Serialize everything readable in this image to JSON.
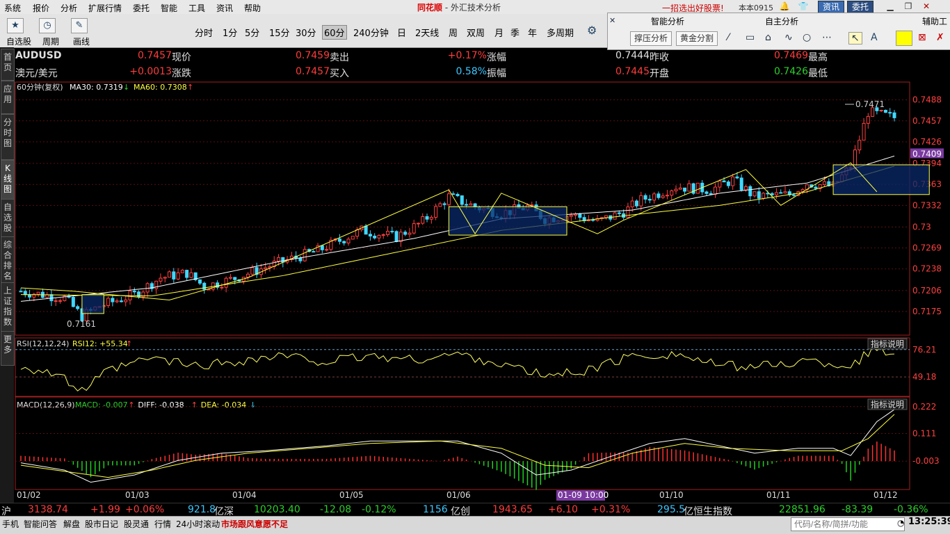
{
  "menu": [
    "系统",
    "报价",
    "分析",
    "扩展行情",
    "委托",
    "智能",
    "工具",
    "资讯",
    "帮助"
  ],
  "app_title": {
    "brand": "同花顺",
    "sep": " - ",
    "title": "外汇技术分析"
  },
  "promo": "一招选出好股票!",
  "version": "本本0915",
  "top_buttons": {
    "news": "资讯",
    "trade": "委托"
  },
  "toolbar": {
    "buttons": [
      {
        "label": "自选股"
      },
      {
        "label": "周期"
      },
      {
        "label": "画线"
      }
    ],
    "periods": [
      "分时",
      "1分",
      "5分",
      "15分",
      "30分",
      "60分",
      "240分钟",
      "日",
      "2天线",
      "周",
      "双周",
      "月",
      "季",
      "年",
      "多周期"
    ],
    "active_period": "60分"
  },
  "analysis_panel": {
    "tabs": [
      "智能分析",
      "自主分析",
      "辅助工"
    ],
    "buttons": [
      "撑压分析",
      "黄金分割"
    ]
  },
  "sidebar": [
    "首页",
    "应用",
    "分时图",
    "K线图",
    "自选股",
    "综合排名",
    "上证指数",
    "更多"
  ],
  "sidebar_active": "K线图",
  "quote": {
    "symbol": "AUDUSD",
    "name": "澳元/美元",
    "fields": [
      {
        "label": "现价",
        "value": "0.7457",
        "color": "#ff3c3c"
      },
      {
        "label": "卖出",
        "value": "0.7459",
        "color": "#ff3c3c"
      },
      {
        "label": "涨幅",
        "value": "+0.17%",
        "color": "#ff3c3c"
      },
      {
        "label": "昨收",
        "value": "0.7444",
        "color": "#e0e0e0"
      },
      {
        "label": "最高",
        "value": "0.7469",
        "color": "#ff3c3c"
      },
      {
        "label": "涨跌",
        "value": "+0.0013",
        "color": "#ff3c3c"
      },
      {
        "label": "买入",
        "value": "0.7457",
        "color": "#ff3c3c"
      },
      {
        "label": "振幅",
        "value": "0.58%",
        "color": "#3cc8ff"
      },
      {
        "label": "开盘",
        "value": "0.7445",
        "color": "#ff3c3c"
      },
      {
        "label": "最低",
        "value": "0.7426",
        "color": "#2bd12b"
      }
    ]
  },
  "chart_data": {
    "type": "candlestick",
    "period_label": "60分钟(复权)",
    "ma_legend": [
      {
        "name": "MA30",
        "value": "0.7319",
        "arrow": "↓",
        "color": "#ffffff"
      },
      {
        "name": "MA60",
        "value": "0.7308",
        "arrow": "↑",
        "color": "#ffff40"
      }
    ],
    "y_ticks": [
      0.7488,
      0.7457,
      0.7426,
      0.7394,
      0.7363,
      0.7332,
      0.73,
      0.7269,
      0.7238,
      0.7206,
      0.7175
    ],
    "ylim": [
      0.714,
      0.75
    ],
    "current_price_tag": "0.7409",
    "annotations": [
      {
        "text": "0.7471",
        "kind": "high"
      },
      {
        "text": "0.7161",
        "kind": "low"
      }
    ],
    "x_labels": [
      "01/02",
      "01/03",
      "01/04",
      "01/05",
      "01/06",
      "01/10",
      "01/11",
      "01/12"
    ],
    "cursor_label": "01-09 10:00",
    "candle_count": 150,
    "anchors": [
      [
        0,
        0.7205
      ],
      [
        10,
        0.7195
      ],
      [
        14,
        0.7168
      ],
      [
        18,
        0.7183
      ],
      [
        26,
        0.72
      ],
      [
        32,
        0.7225
      ],
      [
        38,
        0.7232
      ],
      [
        42,
        0.7212
      ],
      [
        48,
        0.7222
      ],
      [
        58,
        0.7245
      ],
      [
        68,
        0.7265
      ],
      [
        78,
        0.7295
      ],
      [
        86,
        0.7285
      ],
      [
        92,
        0.7308
      ],
      [
        98,
        0.7345
      ],
      [
        104,
        0.733
      ],
      [
        110,
        0.732
      ],
      [
        116,
        0.733
      ],
      [
        120,
        0.7312
      ],
      [
        126,
        0.7318
      ],
      [
        132,
        0.7308
      ],
      [
        138,
        0.7322
      ],
      [
        142,
        0.734
      ],
      [
        150,
        0.736
      ],
      [
        158,
        0.7355
      ],
      [
        163,
        0.737
      ],
      [
        168,
        0.7345
      ],
      [
        176,
        0.7348
      ],
      [
        180,
        0.7365
      ],
      [
        186,
        0.736
      ],
      [
        190,
        0.739
      ],
      [
        194,
        0.747
      ],
      [
        200,
        0.7462
      ]
    ],
    "ma30": [
      [
        0,
        0.719
      ],
      [
        30,
        0.721
      ],
      [
        60,
        0.725
      ],
      [
        90,
        0.7283
      ],
      [
        110,
        0.7312
      ],
      [
        140,
        0.7325
      ],
      [
        160,
        0.735
      ],
      [
        180,
        0.7365
      ],
      [
        200,
        0.7405
      ]
    ],
    "ma60": [
      [
        0,
        0.72
      ],
      [
        30,
        0.7198
      ],
      [
        60,
        0.7228
      ],
      [
        90,
        0.7268
      ],
      [
        110,
        0.7295
      ],
      [
        140,
        0.7318
      ],
      [
        160,
        0.7332
      ],
      [
        180,
        0.7352
      ],
      [
        200,
        0.739
      ]
    ],
    "rsi": {
      "label": "RSI(12,12,24)",
      "value_label": "RSI12: +55.34",
      "arrow": "↑",
      "y_ticks": [
        "76.21",
        "49.18"
      ],
      "ylim": [
        30,
        85
      ],
      "anchors": [
        [
          0,
          60
        ],
        [
          8,
          52
        ],
        [
          14,
          35
        ],
        [
          20,
          55
        ],
        [
          30,
          68
        ],
        [
          40,
          60
        ],
        [
          50,
          65
        ],
        [
          60,
          70
        ],
        [
          70,
          64
        ],
        [
          80,
          70
        ],
        [
          90,
          66
        ],
        [
          100,
          72
        ],
        [
          110,
          62
        ],
        [
          120,
          50
        ],
        [
          130,
          56
        ],
        [
          140,
          70
        ],
        [
          150,
          72
        ],
        [
          160,
          60
        ],
        [
          170,
          60
        ],
        [
          180,
          65
        ],
        [
          190,
          60
        ],
        [
          195,
          76
        ],
        [
          200,
          72
        ]
      ]
    },
    "macd": {
      "label": "MACD(12,26,9)",
      "legend": [
        {
          "name": "MACD",
          "value": "-0.007",
          "arrow": "↑",
          "color": "#2bd12b"
        },
        {
          "name": "DIFF",
          "value": "-0.038",
          "arrow": "↑",
          "color": "#ffffff"
        },
        {
          "name": "DEA",
          "value": "-0.034",
          "arrow": "↓",
          "color": "#ffff40"
        }
      ],
      "y_ticks": [
        "0.222",
        "0.111",
        "-0.003"
      ],
      "ylim": [
        -0.12,
        0.25
      ],
      "diff_anchors": [
        [
          0,
          -0.01
        ],
        [
          10,
          -0.04
        ],
        [
          16,
          -0.09
        ],
        [
          26,
          -0.06
        ],
        [
          36,
          0.0
        ],
        [
          46,
          0.03
        ],
        [
          56,
          0.04
        ],
        [
          70,
          0.06
        ],
        [
          80,
          0.08
        ],
        [
          90,
          0.08
        ],
        [
          100,
          0.08
        ],
        [
          110,
          0.03
        ],
        [
          118,
          -0.06
        ],
        [
          126,
          -0.04
        ],
        [
          134,
          0.01
        ],
        [
          144,
          0.07
        ],
        [
          152,
          0.09
        ],
        [
          160,
          0.06
        ],
        [
          168,
          0.03
        ],
        [
          178,
          0.05
        ],
        [
          186,
          0.05
        ],
        [
          190,
          0.02
        ],
        [
          196,
          0.16
        ],
        [
          200,
          0.21
        ]
      ],
      "dea_anchors": [
        [
          0,
          -0.02
        ],
        [
          12,
          -0.05
        ],
        [
          20,
          -0.07
        ],
        [
          30,
          -0.04
        ],
        [
          40,
          0.0
        ],
        [
          52,
          0.03
        ],
        [
          66,
          0.05
        ],
        [
          80,
          0.07
        ],
        [
          96,
          0.08
        ],
        [
          110,
          0.05
        ],
        [
          120,
          -0.02
        ],
        [
          130,
          -0.03
        ],
        [
          140,
          0.03
        ],
        [
          152,
          0.07
        ],
        [
          162,
          0.05
        ],
        [
          176,
          0.04
        ],
        [
          188,
          0.04
        ],
        [
          194,
          0.09
        ],
        [
          200,
          0.19
        ]
      ]
    }
  },
  "indicator_help": "指标说明",
  "index_bar": [
    {
      "text": "沪",
      "color": "#e0e0e0"
    },
    {
      "text": "3138.74",
      "color": "#ff3c3c"
    },
    {
      "text": "+1.99",
      "color": "#ff3c3c"
    },
    {
      "text": "+0.06%",
      "color": "#ff3c3c"
    },
    {
      "text": "921.8",
      "color": "#3cc8ff"
    },
    {
      "text": "亿深",
      "color": "#e0e0e0"
    },
    {
      "text": "10203.40",
      "color": "#2bd12b"
    },
    {
      "text": "-12.08",
      "color": "#2bd12b"
    },
    {
      "text": "-0.12%",
      "color": "#2bd12b"
    },
    {
      "text": "1156",
      "color": "#3cc8ff"
    },
    {
      "text": "亿创",
      "color": "#e0e0e0"
    },
    {
      "text": "1943.65",
      "color": "#ff3c3c"
    },
    {
      "text": "+6.10",
      "color": "#ff3c3c"
    },
    {
      "text": "+0.31%",
      "color": "#ff3c3c"
    },
    {
      "text": "295.5",
      "color": "#3cc8ff"
    },
    {
      "text": "亿恒生指数",
      "color": "#e0e0e0"
    },
    {
      "text": "22851.96",
      "color": "#2bd12b"
    },
    {
      "text": "-83.39",
      "color": "#2bd12b"
    },
    {
      "text": "-0.36%",
      "color": "#2bd12b"
    }
  ],
  "status_bar": {
    "items": [
      "手机",
      "智能问答",
      "解盘",
      "股市日记",
      "股灵通",
      "行情",
      "24小时滚动"
    ],
    "ticker": "市场跟风意愿不足",
    "search_placeholder": "代码/名称/简拼/功能",
    "clock": "13:25:39"
  }
}
